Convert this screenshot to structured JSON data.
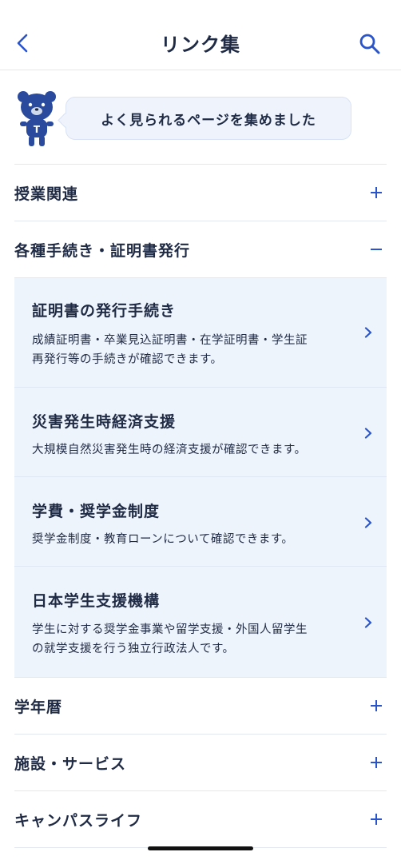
{
  "header": {
    "title": "リンク集",
    "back_icon": "chevron-left-icon",
    "search_icon": "search-icon"
  },
  "intro": {
    "message": "よく見られるページを集めました",
    "mascot_letter": "T"
  },
  "sections": [
    {
      "title": "授業関連",
      "expanded": false
    },
    {
      "title": "各種手続き・証明書発行",
      "expanded": true,
      "items": [
        {
          "title": "証明書の発行手続き",
          "desc_lines": [
            "成績証明書・卒業見込証明書・在学証明書・学生証",
            "再発行等の手続きが確認できます。"
          ]
        },
        {
          "title": "災害発生時経済支援",
          "desc_lines": [
            "大規模自然災害発生時の経済支援が確認できます。"
          ]
        },
        {
          "title": "学費・奨学金制度",
          "desc_lines": [
            "奨学金制度・教育ローンについて確認できます。"
          ]
        },
        {
          "title": "日本学生支援機構",
          "desc_lines": [
            "学生に対する奨学金事業や留学支援・外国人留学生",
            "の就学支援を行う独立行政法人です。"
          ]
        }
      ]
    },
    {
      "title": "学年暦",
      "expanded": false
    },
    {
      "title": "施設・サービス",
      "expanded": false
    },
    {
      "title": "キャンパスライフ",
      "expanded": false
    }
  ],
  "colors": {
    "accent": "#2a54c9",
    "text": "#1f2a44",
    "sub_bg": "#eef4fc"
  }
}
